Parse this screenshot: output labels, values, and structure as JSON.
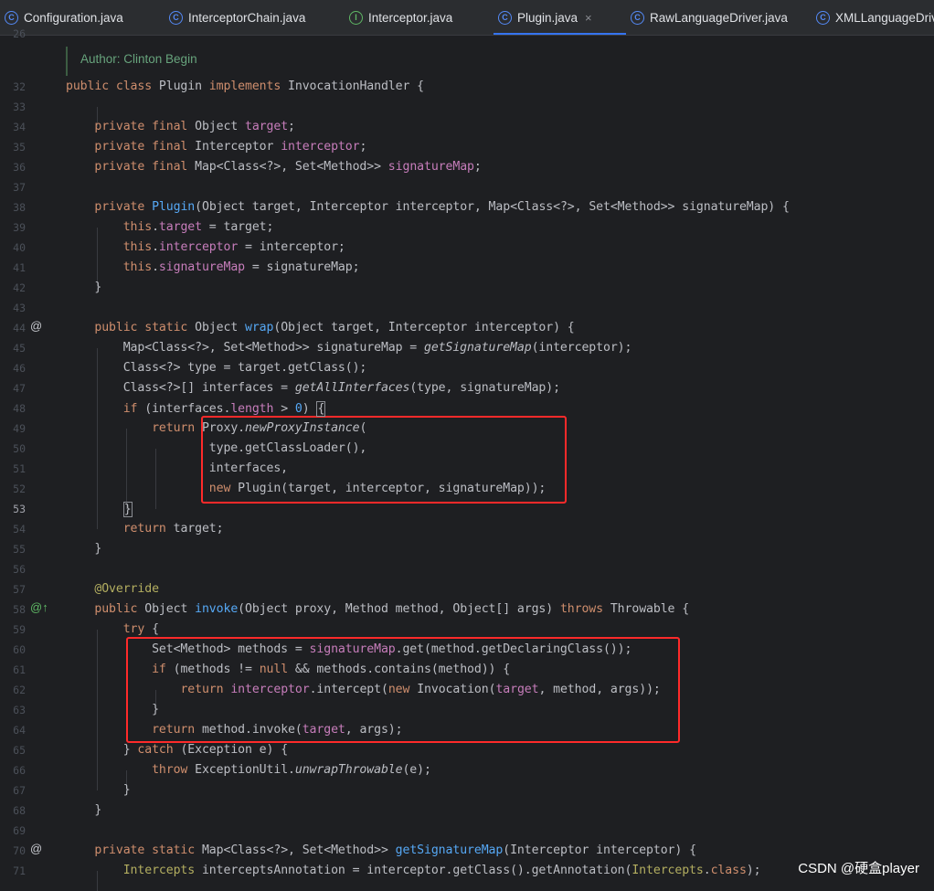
{
  "tabs": [
    {
      "label": "Configuration.java",
      "icon": "class-icon",
      "icon_glyph": "C"
    },
    {
      "label": "InterceptorChain.java",
      "icon": "class-icon",
      "icon_glyph": "C"
    },
    {
      "label": "Interceptor.java",
      "icon": "interface-icon",
      "icon_glyph": "I"
    },
    {
      "label": "Plugin.java",
      "icon": "class-icon",
      "icon_glyph": "C",
      "active": true,
      "close": "×"
    },
    {
      "label": "RawLanguageDriver.java",
      "icon": "class-icon",
      "icon_glyph": "C"
    },
    {
      "label": "XMLLanguageDriver",
      "icon": "class-icon",
      "icon_glyph": "C"
    }
  ],
  "editor": {
    "doc_comment": "Author: Clinton Begin",
    "top_partial_line": "26",
    "lines": [
      {
        "n": "32",
        "html": "<span class=\"kw\">public class</span> Plugin <span class=\"kw\">implements</span> InvocationHandler {"
      },
      {
        "n": "33",
        "html": ""
      },
      {
        "n": "34",
        "html": "    <span class=\"kw\">private final</span> Object <span class=\"fld\">target</span>;"
      },
      {
        "n": "35",
        "html": "    <span class=\"kw\">private final</span> Interceptor <span class=\"fld\">interceptor</span>;"
      },
      {
        "n": "36",
        "html": "    <span class=\"kw\">private final</span> Map&lt;Class&lt;?&gt;, Set&lt;Method&gt;&gt; <span class=\"fld\">signatureMap</span>;"
      },
      {
        "n": "37",
        "html": ""
      },
      {
        "n": "38",
        "html": "    <span class=\"kw\">private</span> <span class=\"fn\">Plugin</span>(Object target, Interceptor interceptor, Map&lt;Class&lt;?&gt;, Set&lt;Method&gt;&gt; signatureMap) {"
      },
      {
        "n": "39",
        "html": "        <span class=\"kw\">this</span>.<span class=\"fld\">target</span> = target;"
      },
      {
        "n": "40",
        "html": "        <span class=\"kw\">this</span>.<span class=\"fld\">interceptor</span> = interceptor;"
      },
      {
        "n": "41",
        "html": "        <span class=\"kw\">this</span>.<span class=\"fld\">signatureMap</span> = signatureMap;"
      },
      {
        "n": "42",
        "html": "    }"
      },
      {
        "n": "43",
        "html": ""
      },
      {
        "n": "44",
        "mark": "@",
        "html": "    <span class=\"kw\">public static</span> Object <span class=\"fn\">wrap</span>(Object target, Interceptor interceptor) {"
      },
      {
        "n": "45",
        "html": "        Map&lt;Class&lt;?&gt;, Set&lt;Method&gt;&gt; signatureMap = <span class=\"it\">getSignatureMap</span>(interceptor);"
      },
      {
        "n": "46",
        "html": "        Class&lt;?&gt; type = target.getClass();"
      },
      {
        "n": "47",
        "html": "        Class&lt;?&gt;[] interfaces = <span class=\"it\">getAllInterfaces</span>(type, signatureMap);"
      },
      {
        "n": "48",
        "html": "        <span class=\"kw\">if</span> (interfaces.<span class=\"fld\">length</span> &gt; <span class=\"fn\">0</span>) <span class=\"caret-box\">{</span>"
      },
      {
        "n": "49",
        "html": "            <span class=\"kw\">return</span> Proxy.<span class=\"it\">newProxyInstance</span>("
      },
      {
        "n": "50",
        "html": "                    type.getClassLoader(),"
      },
      {
        "n": "51",
        "html": "                    interfaces,"
      },
      {
        "n": "52",
        "html": "                    <span class=\"kw\">new</span> Plugin(target, interceptor, signatureMap));"
      },
      {
        "n": "53",
        "cur": true,
        "html": "        <span class=\"caret-box\">}</span>"
      },
      {
        "n": "54",
        "html": "        <span class=\"kw\">return</span> target;"
      },
      {
        "n": "55",
        "html": "    }"
      },
      {
        "n": "56",
        "html": ""
      },
      {
        "n": "57",
        "html": "    <span class=\"ann\">@Override</span>"
      },
      {
        "n": "58",
        "mark": "@↑",
        "markClass": "green",
        "html": "    <span class=\"kw\">public</span> Object <span class=\"fn\">invoke</span>(Object proxy, Method method, Object[] args) <span class=\"kw\">throws</span> Throwable {"
      },
      {
        "n": "59",
        "html": "        <span class=\"kw\">try</span> {"
      },
      {
        "n": "60",
        "html": "            Set&lt;Method&gt; methods = <span class=\"fld\">signatureMap</span>.get(method.getDeclaringClass());"
      },
      {
        "n": "61",
        "html": "            <span class=\"kw\">if</span> (methods != <span class=\"kw\">null</span> &amp;&amp; methods.contains(method)) {"
      },
      {
        "n": "62",
        "html": "                <span class=\"kw\">return</span> <span class=\"fld\">interceptor</span>.intercept(<span class=\"kw\">new</span> Invocation(<span class=\"fld\">target</span>, method, args));"
      },
      {
        "n": "63",
        "html": "            }"
      },
      {
        "n": "64",
        "html": "            <span class=\"kw\">return</span> method.invoke(<span class=\"fld\">target</span>, args);"
      },
      {
        "n": "65",
        "html": "        } <span class=\"kw\">catch</span> (Exception e) {"
      },
      {
        "n": "66",
        "html": "            <span class=\"kw\">throw</span> ExceptionUtil.<span class=\"it\">unwrapThrowable</span>(e);"
      },
      {
        "n": "67",
        "html": "        }"
      },
      {
        "n": "68",
        "html": "    }"
      },
      {
        "n": "69",
        "html": ""
      },
      {
        "n": "70",
        "mark": "@",
        "html": "    <span class=\"kw\">private static</span> Map&lt;Class&lt;?&gt;, Set&lt;Method&gt;&gt; <span class=\"fn\">getSignatureMap</span>(Interceptor interceptor) {"
      },
      {
        "n": "71",
        "html": "        <span class=\"ann\">Intercepts</span> interceptsAnnotation = interceptor.getClass().getAnnotation(<span class=\"ann\">Intercepts</span>.<span class=\"kw\">class</span>);"
      }
    ]
  },
  "watermark": "CSDN @硬盒player",
  "colors": {
    "highlight_box": "#ff2a2a",
    "active_tab_underline": "#3574f0",
    "background": "#1e1f22"
  }
}
